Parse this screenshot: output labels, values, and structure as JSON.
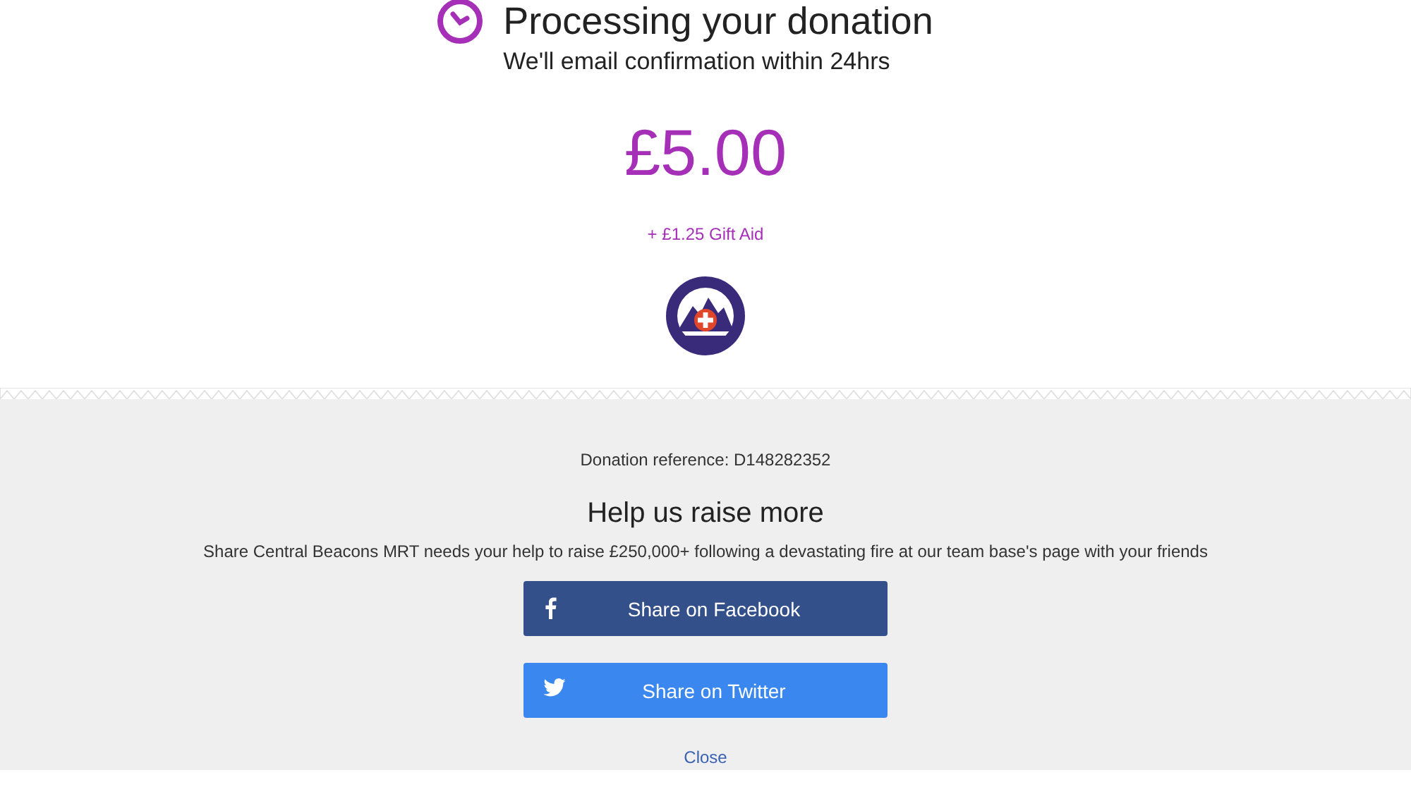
{
  "header": {
    "title": "Processing your donation",
    "subtitle": "We'll email confirmation within 24hrs"
  },
  "amount": "£5.00",
  "gift_aid": "+ £1.25 Gift Aid",
  "reference": {
    "label": "Donation reference:",
    "value": "D148282352"
  },
  "share": {
    "title": "Help us raise more",
    "message": "Share Central Beacons MRT needs your help to raise £250,000+ following a devastating fire at our team base's page with your friends",
    "buttons": [
      {
        "kind": "facebook",
        "label": "Share on Facebook"
      },
      {
        "kind": "twitter",
        "label": "Share on Twitter"
      }
    ],
    "close": "Close"
  }
}
